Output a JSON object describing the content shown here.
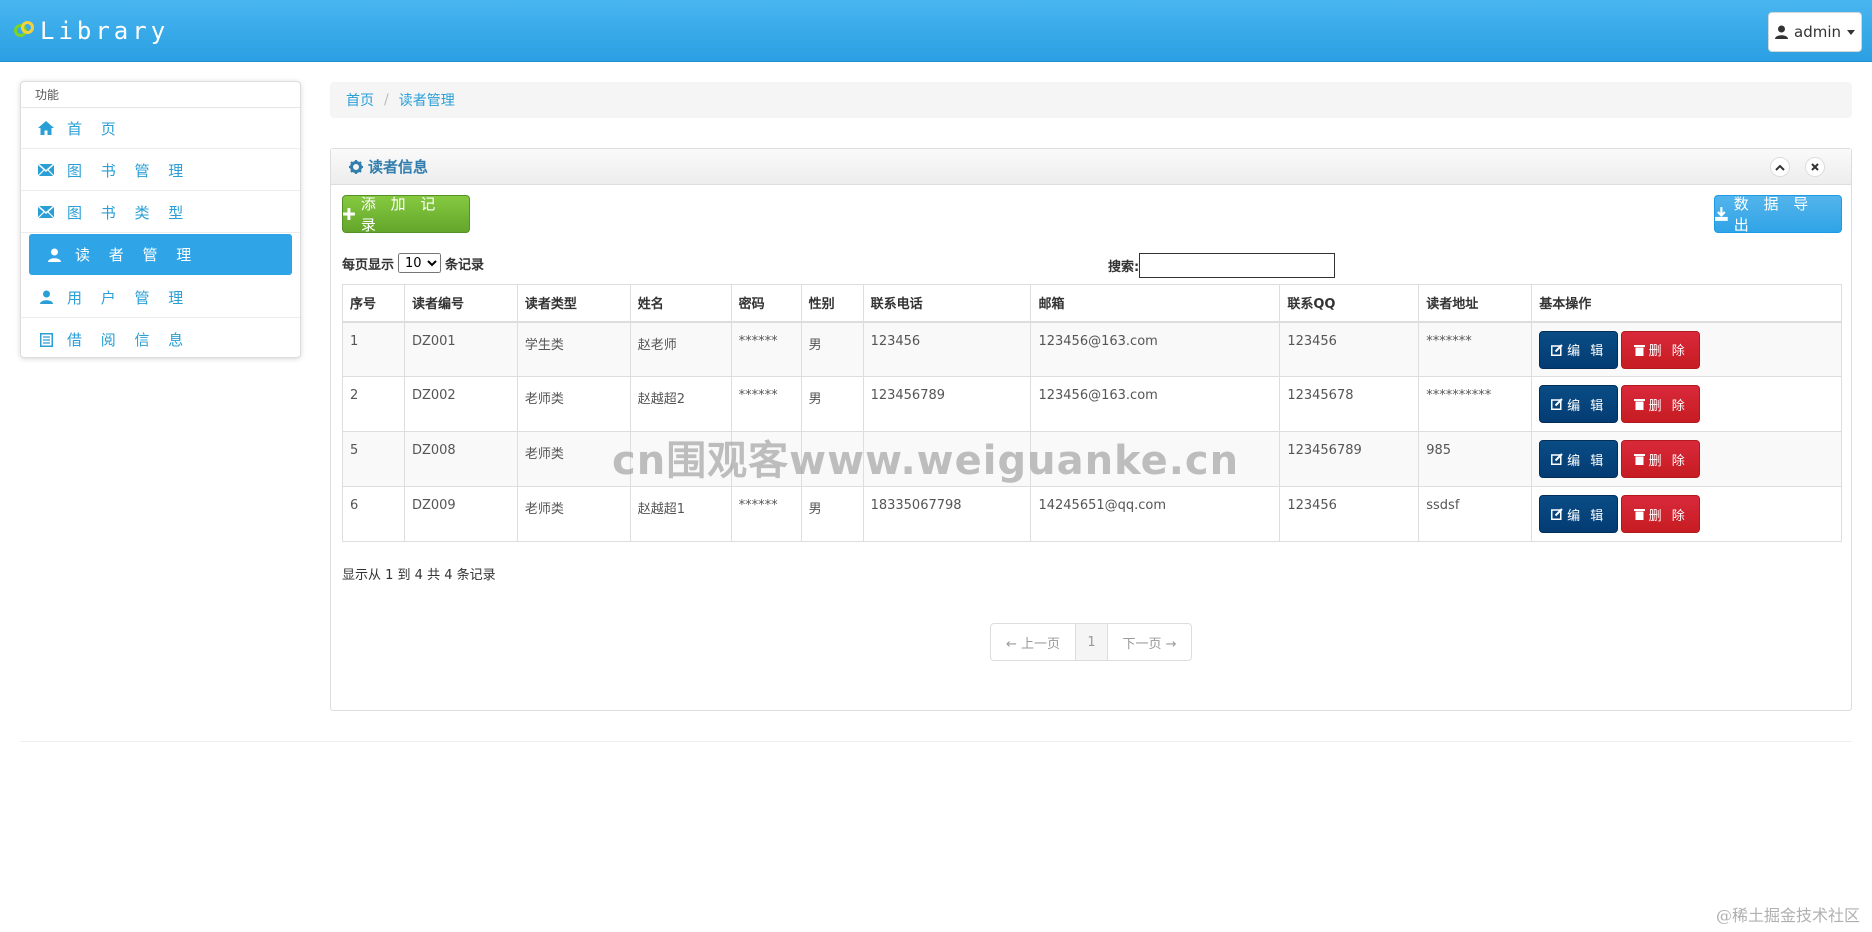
{
  "navbar": {
    "brand": "Library",
    "user_label": "admin"
  },
  "sidebar": {
    "heading": "功能",
    "items": [
      {
        "label": "首 页",
        "icon": "home-icon"
      },
      {
        "label": "图 书 管 理",
        "icon": "envelope-icon"
      },
      {
        "label": "图 书 类 型",
        "icon": "envelope-icon"
      },
      {
        "label": "读 者 管 理",
        "icon": "user-icon",
        "active": true
      },
      {
        "label": "用 户 管 理",
        "icon": "user-icon"
      },
      {
        "label": "借 阅 信 息",
        "icon": "list-icon"
      }
    ]
  },
  "breadcrumb": {
    "home": "首页",
    "current": "读者管理"
  },
  "panel": {
    "title": "读者信息",
    "add_label": "添 加 记 录",
    "export_label": "数 据 导 出",
    "length_prefix": "每页显示",
    "length_value": "10",
    "length_suffix": "条记录",
    "search_label": "搜索:",
    "search_value": ""
  },
  "table": {
    "headers": [
      "序号",
      "读者编号",
      "读者类型",
      "姓名",
      "密码",
      "性别",
      "联系电话",
      "邮箱",
      "联系QQ",
      "读者地址",
      "基本操作"
    ],
    "rows": [
      [
        "1",
        "DZ001",
        "学生类",
        "赵老师",
        "******",
        "男",
        "123456",
        "123456@163.com",
        "123456",
        "*******"
      ],
      [
        "2",
        "DZ002",
        "老师类",
        "赵越超2",
        "******",
        "男",
        "123456789",
        "123456@163.com",
        "12345678",
        "**********"
      ],
      [
        "5",
        "DZ008",
        "老师类",
        "",
        "",
        "",
        "",
        "",
        "123456789",
        "985"
      ],
      [
        "6",
        "DZ009",
        "老师类",
        "赵越超1",
        "******",
        "男",
        "18335067798",
        "14245651@qq.com",
        "123456",
        "ssdsf"
      ]
    ],
    "edit_label": "编 辑",
    "delete_label": "删 除"
  },
  "footer_info": "显示从 1 到 4 共 4 条记录",
  "pager": {
    "prev": "← 上一页",
    "page": "1",
    "next": "下一页 →"
  },
  "watermark": "cn围观客www.weiguanke.cn",
  "corner_mark": "@稀土掘金技术社区"
}
